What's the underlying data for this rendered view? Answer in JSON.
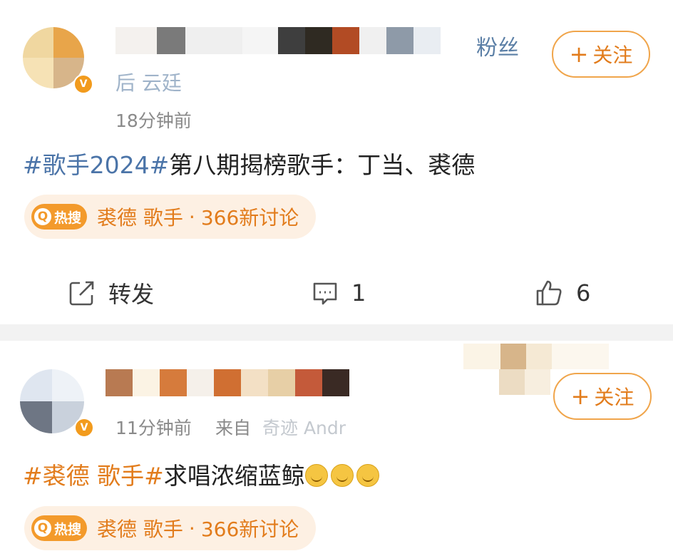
{
  "post1": {
    "name_suffix": "粉丝",
    "name_line2_fragment": "后 云廷",
    "time": "18分钟前",
    "follow_label": "关注",
    "follow_plus": "+",
    "hashtag": "#歌手2024#",
    "text": "第八期揭榜歌手：丁当、裘德",
    "hot": {
      "badge": "热搜",
      "topic": "裘德 歌手",
      "sep": "·",
      "count": "366新讨论"
    },
    "actions": {
      "repost": "转发",
      "comments": "1",
      "likes": "6"
    }
  },
  "post2": {
    "time": "11分钟前",
    "source_prefix": "来自",
    "source_fragment": "奇迹 Andr",
    "follow_label": "关注",
    "follow_plus": "+",
    "hashtag": "#裘德 歌手#",
    "text": "求唱浓缩蓝鲸",
    "hot": {
      "badge": "热搜",
      "topic": "裘德 歌手",
      "sep": "·",
      "count": "366新讨论"
    }
  },
  "colors": {
    "accent_orange": "#e27c1c",
    "hashtag_blue": "#4b74a8",
    "divider": "#f2f2f2"
  },
  "icons": [
    "verified-badge-icon",
    "repost-icon",
    "comment-icon",
    "like-icon",
    "hot-search-icon",
    "laugh-cry-emoji-icon"
  ]
}
